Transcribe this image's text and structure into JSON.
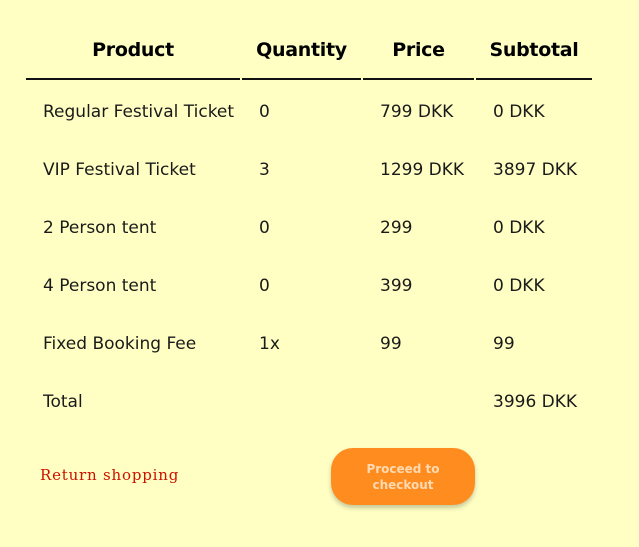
{
  "table": {
    "headers": {
      "product": "Product",
      "quantity": "Quantity",
      "price": "Price",
      "subtotal": "Subtotal"
    },
    "rows": [
      {
        "product": "Regular Festival Ticket",
        "quantity": "0",
        "price": "799 DKK",
        "subtotal": "0 DKK"
      },
      {
        "product": "VIP Festival Ticket",
        "quantity": "3",
        "price": "1299 DKK",
        "subtotal": "3897 DKK"
      },
      {
        "product": "2 Person tent",
        "quantity": "0",
        "price": "299",
        "subtotal": "0 DKK"
      },
      {
        "product": "4 Person tent",
        "quantity": "0",
        "price": "399",
        "subtotal": "0 DKK"
      },
      {
        "product": "Fixed Booking Fee",
        "quantity": "1x",
        "price": "99",
        "subtotal": "99"
      }
    ],
    "total": {
      "label": "Total",
      "value": "3996 DKK"
    }
  },
  "actions": {
    "return_label": "Return shopping",
    "checkout_label": "Proceed to checkout"
  },
  "colors": {
    "background": "#ffffc4",
    "checkout_button": "#ff8c1f",
    "return_link": "#cc1100"
  }
}
